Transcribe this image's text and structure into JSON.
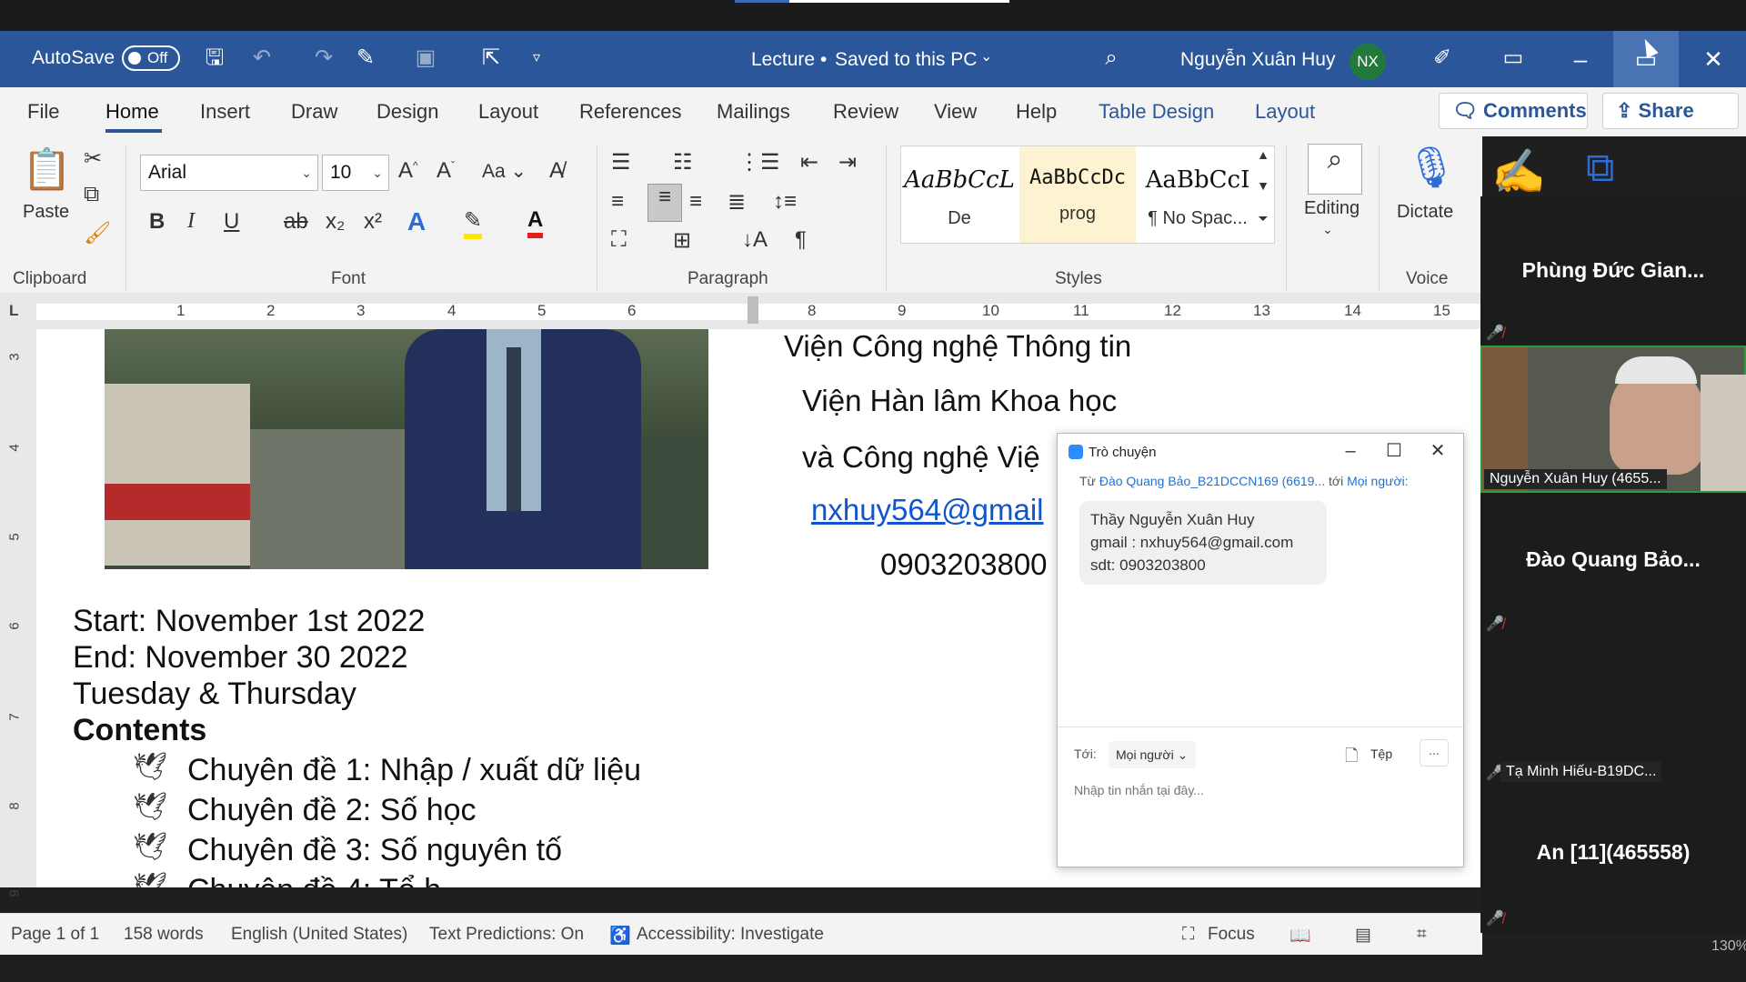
{
  "titlebar": {
    "autosave_label": "AutoSave",
    "autosave_state": "Off",
    "doc_title": "Lecture",
    "save_status": "Saved to this PC",
    "user_name": "Nguyễn Xuân Huy",
    "user_initials": "NX"
  },
  "menubar": {
    "tabs": [
      "File",
      "Home",
      "Insert",
      "Draw",
      "Design",
      "Layout",
      "References",
      "Mailings",
      "Review",
      "View",
      "Help",
      "Table Design",
      "Layout"
    ],
    "comments_label": "Comments",
    "share_label": "Share"
  },
  "ribbon": {
    "clipboard": {
      "paste_label": "Paste",
      "group_label": "Clipboard"
    },
    "font": {
      "family": "Arial",
      "size": "10",
      "case_label": "Aa",
      "group_label": "Font",
      "bold": "B",
      "italic": "I",
      "underline": "U",
      "strike": "ab",
      "sub": "x₂",
      "sup": "x²"
    },
    "paragraph": {
      "group_label": "Paragraph"
    },
    "styles": {
      "group_label": "Styles",
      "items": [
        {
          "preview": "AaBbCcL",
          "name": "De"
        },
        {
          "preview": "AaBbCcDc",
          "name": "prog"
        },
        {
          "preview": "AaBbCcI",
          "name": "¶ No Spac..."
        }
      ]
    },
    "editing_label": "Editing",
    "dictate_label": "Dictate",
    "voice_group_label": "Voice"
  },
  "ruler": {
    "h_numbers": [
      "1",
      "2",
      "3",
      "4",
      "5",
      "6",
      "8",
      "9",
      "10",
      "11",
      "12",
      "13",
      "14",
      "15"
    ],
    "v_numbers": [
      "3",
      "4",
      "5",
      "6",
      "7",
      "8",
      "9"
    ]
  },
  "document": {
    "org_lines": [
      "Viện Công nghệ Thông tin",
      "Viện Hàn lâm Khoa học",
      "và Công nghệ Việ"
    ],
    "email": "nxhuy564@gmail",
    "phone": "0903203800",
    "schedule": [
      "Start: November 1st 2022",
      "End: November 30 2022",
      "Tuesday & Thursday"
    ],
    "contents_heading": "Contents",
    "topics": [
      "Chuyên đề 1: Nhập / xuất dữ liệu",
      "Chuyên đề 2: Số học",
      "Chuyên đề 3: Số nguyên tố"
    ],
    "cut_topic": "Chuyên đề 4: Tổ h"
  },
  "statusbar": {
    "page": "Page 1 of 1",
    "words": "158 words",
    "language": "English (United States)",
    "predictions": "Text Predictions: On",
    "accessibility": "Accessibility: Investigate",
    "focus": "Focus",
    "zoom": "130%"
  },
  "participants": [
    {
      "name": "Phùng Đức Gian...",
      "muted": true
    },
    {
      "name": "Nguyễn Xuân Huy (4655...",
      "video": true
    },
    {
      "name": "Đào Quang Bảo...",
      "muted": true
    },
    {
      "name": "Tạ Minh Hiếu-B19DC...",
      "muted": true
    },
    {
      "name": "An [11](465558)",
      "muted": true
    }
  ],
  "chat": {
    "title": "Trò chuyện",
    "from_prefix": "Từ",
    "from_name": "Đào Quang Bảo_B21DCCN169 (6619...",
    "to_prefix": "tới",
    "to_name": "Mọi người:",
    "message_lines": [
      "Thầy Nguyễn Xuân Huy",
      "gmail : nxhuy564@gmail.com",
      "sdt: 0903203800"
    ],
    "to_label": "Tới:",
    "recipient": "Mọi người",
    "file_label": "Tệp",
    "more_label": "...",
    "input_placeholder": "Nhập tin nhắn tại đây..."
  },
  "colors": {
    "word_blue": "#2b579a",
    "avatar_green": "#217a3b",
    "zoom_blue": "#2d8cff",
    "mute_red": "#e0312f"
  }
}
